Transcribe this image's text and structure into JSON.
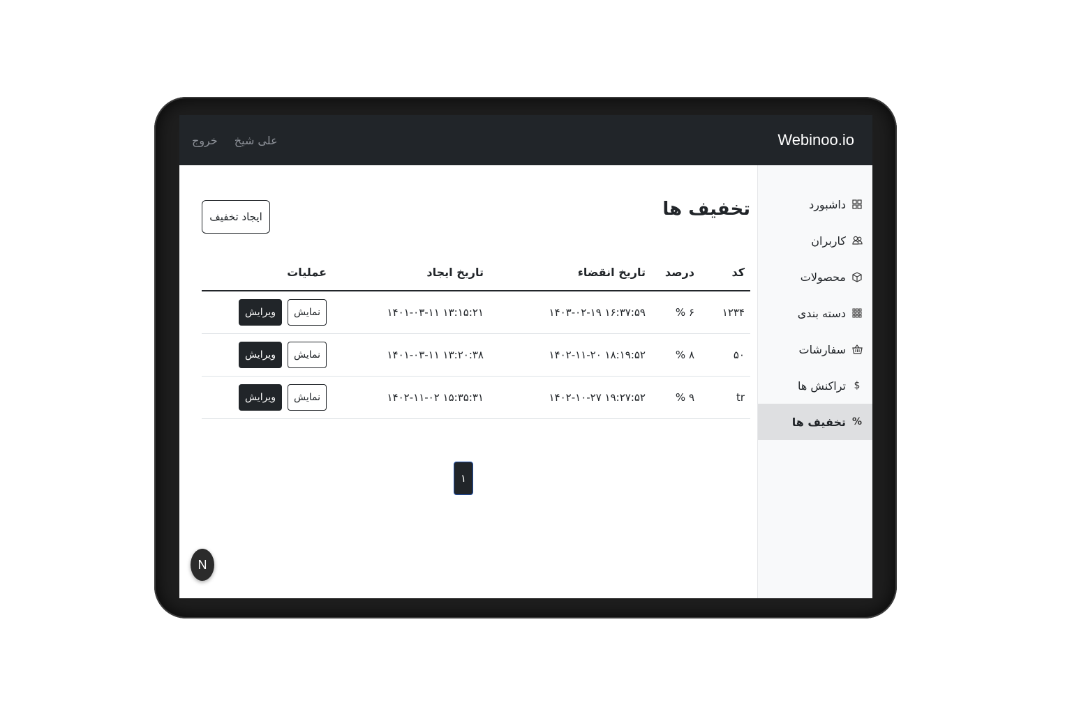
{
  "navbar": {
    "brand": "Webinoo.io",
    "user_name": "علی شیخ",
    "logout_label": "خروج"
  },
  "sidebar": {
    "items": [
      {
        "label": "داشبورد",
        "icon": "grid-icon"
      },
      {
        "label": "کاربران",
        "icon": "users-icon"
      },
      {
        "label": "محصولات",
        "icon": "box-icon"
      },
      {
        "label": "دسته بندی",
        "icon": "apps-icon"
      },
      {
        "label": "سفارشات",
        "icon": "basket-icon"
      },
      {
        "label": "تراکنش ها",
        "icon": "dollar-icon"
      },
      {
        "label": "تخفیف ها",
        "icon": "percent-icon",
        "active": true
      }
    ]
  },
  "main": {
    "title": "تخفیف ها",
    "create_button_label": "ایجاد تخفیف",
    "table": {
      "headers": {
        "code": "کد",
        "percent": "درصد",
        "expire": "تاریخ انقضاء",
        "created": "تاریخ ایجاد",
        "operations": "عملیات"
      },
      "rows": [
        {
          "code": "۱۲۳۴",
          "percent": "۶ %",
          "expire": "۱۴۰۳-۰۲-۱۹ ۱۶:۳۷:۵۹",
          "created": "۱۴۰۱-۰۳-۱۱ ۱۳:۱۵:۲۱"
        },
        {
          "code": "۵۰",
          "percent": "۸ %",
          "expire": "۱۴۰۲-۱۱-۲۰ ۱۸:۱۹:۵۲",
          "created": "۱۴۰۱-۰۳-۱۱ ۱۳:۲۰:۳۸"
        },
        {
          "code": "tr",
          "percent": "۹ %",
          "expire": "۱۴۰۲-۱۰-۲۷ ۱۹:۲۷:۵۲",
          "created": "۱۴۰۲-۱۱-۰۲ ۱۵:۳۵:۳۱"
        }
      ],
      "view_label": "نمایش",
      "edit_label": "ویرایش"
    },
    "pagination": {
      "current_page": "۱"
    }
  },
  "badge": {
    "letter": "N"
  },
  "colors": {
    "navbar_bg": "#212529",
    "sidebar_bg": "#f8f9fa",
    "active_item_bg": "#dedfe1",
    "device_frame": "#1e1e1e"
  }
}
